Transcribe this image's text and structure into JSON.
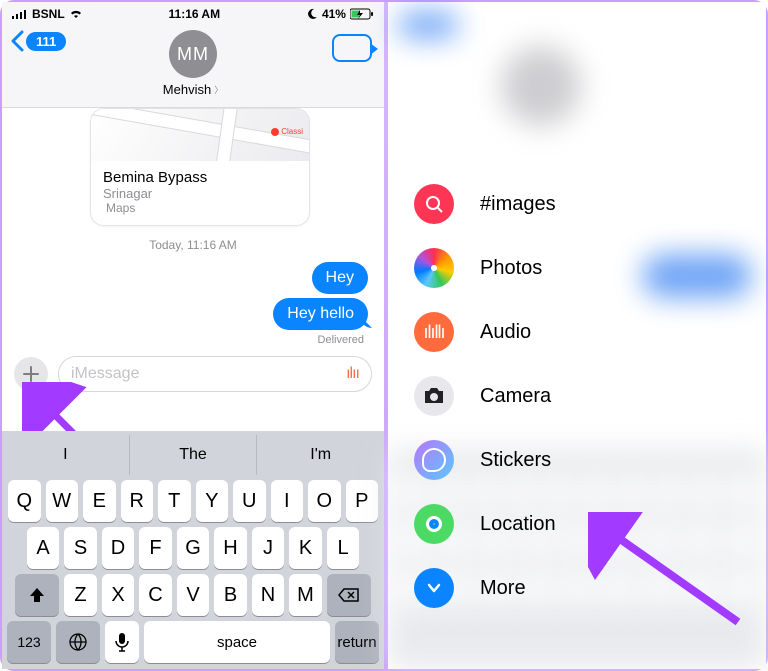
{
  "status_bar": {
    "carrier": "BSNL",
    "time": "11:16 AM",
    "battery_percent": "41%"
  },
  "header": {
    "back_count": "111",
    "avatar_initials": "MM",
    "contact_name": "Mehvish"
  },
  "location_card": {
    "poi": "Classi",
    "title": "Bemina Bypass",
    "subtitle": "Srinagar",
    "app": "Maps"
  },
  "thread": {
    "timestamp": "Today, 11:16 AM",
    "messages": [
      {
        "text": "Hey"
      },
      {
        "text": "Hey hello"
      }
    ],
    "status": "Delivered"
  },
  "composer": {
    "placeholder": "iMessage"
  },
  "keyboard": {
    "suggestions": [
      "I",
      "The",
      "I'm"
    ],
    "row1": [
      "Q",
      "W",
      "E",
      "R",
      "T",
      "Y",
      "U",
      "I",
      "O",
      "P"
    ],
    "row2": [
      "A",
      "S",
      "D",
      "F",
      "G",
      "H",
      "J",
      "K",
      "L"
    ],
    "row3": [
      "Z",
      "X",
      "C",
      "V",
      "B",
      "N",
      "M"
    ],
    "numbers_key": "123",
    "space_key": "space",
    "return_key": "return"
  },
  "app_menu": {
    "items": [
      {
        "id": "images",
        "label": "#images"
      },
      {
        "id": "photos",
        "label": "Photos"
      },
      {
        "id": "audio",
        "label": "Audio"
      },
      {
        "id": "camera",
        "label": "Camera"
      },
      {
        "id": "stickers",
        "label": "Stickers"
      },
      {
        "id": "location",
        "label": "Location"
      },
      {
        "id": "more",
        "label": "More"
      }
    ]
  }
}
